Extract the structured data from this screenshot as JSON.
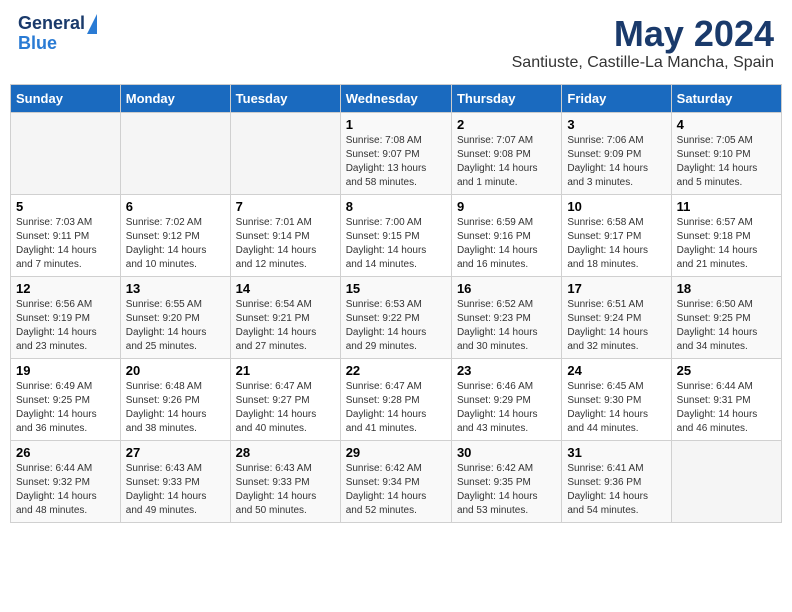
{
  "header": {
    "logo_general": "General",
    "logo_blue": "Blue",
    "month": "May 2024",
    "location": "Santiuste, Castille-La Mancha, Spain"
  },
  "days_of_week": [
    "Sunday",
    "Monday",
    "Tuesday",
    "Wednesday",
    "Thursday",
    "Friday",
    "Saturday"
  ],
  "weeks": [
    [
      {
        "day": "",
        "info": ""
      },
      {
        "day": "",
        "info": ""
      },
      {
        "day": "",
        "info": ""
      },
      {
        "day": "1",
        "info": "Sunrise: 7:08 AM\nSunset: 9:07 PM\nDaylight: 13 hours\nand 58 minutes."
      },
      {
        "day": "2",
        "info": "Sunrise: 7:07 AM\nSunset: 9:08 PM\nDaylight: 14 hours\nand 1 minute."
      },
      {
        "day": "3",
        "info": "Sunrise: 7:06 AM\nSunset: 9:09 PM\nDaylight: 14 hours\nand 3 minutes."
      },
      {
        "day": "4",
        "info": "Sunrise: 7:05 AM\nSunset: 9:10 PM\nDaylight: 14 hours\nand 5 minutes."
      }
    ],
    [
      {
        "day": "5",
        "info": "Sunrise: 7:03 AM\nSunset: 9:11 PM\nDaylight: 14 hours\nand 7 minutes."
      },
      {
        "day": "6",
        "info": "Sunrise: 7:02 AM\nSunset: 9:12 PM\nDaylight: 14 hours\nand 10 minutes."
      },
      {
        "day": "7",
        "info": "Sunrise: 7:01 AM\nSunset: 9:14 PM\nDaylight: 14 hours\nand 12 minutes."
      },
      {
        "day": "8",
        "info": "Sunrise: 7:00 AM\nSunset: 9:15 PM\nDaylight: 14 hours\nand 14 minutes."
      },
      {
        "day": "9",
        "info": "Sunrise: 6:59 AM\nSunset: 9:16 PM\nDaylight: 14 hours\nand 16 minutes."
      },
      {
        "day": "10",
        "info": "Sunrise: 6:58 AM\nSunset: 9:17 PM\nDaylight: 14 hours\nand 18 minutes."
      },
      {
        "day": "11",
        "info": "Sunrise: 6:57 AM\nSunset: 9:18 PM\nDaylight: 14 hours\nand 21 minutes."
      }
    ],
    [
      {
        "day": "12",
        "info": "Sunrise: 6:56 AM\nSunset: 9:19 PM\nDaylight: 14 hours\nand 23 minutes."
      },
      {
        "day": "13",
        "info": "Sunrise: 6:55 AM\nSunset: 9:20 PM\nDaylight: 14 hours\nand 25 minutes."
      },
      {
        "day": "14",
        "info": "Sunrise: 6:54 AM\nSunset: 9:21 PM\nDaylight: 14 hours\nand 27 minutes."
      },
      {
        "day": "15",
        "info": "Sunrise: 6:53 AM\nSunset: 9:22 PM\nDaylight: 14 hours\nand 29 minutes."
      },
      {
        "day": "16",
        "info": "Sunrise: 6:52 AM\nSunset: 9:23 PM\nDaylight: 14 hours\nand 30 minutes."
      },
      {
        "day": "17",
        "info": "Sunrise: 6:51 AM\nSunset: 9:24 PM\nDaylight: 14 hours\nand 32 minutes."
      },
      {
        "day": "18",
        "info": "Sunrise: 6:50 AM\nSunset: 9:25 PM\nDaylight: 14 hours\nand 34 minutes."
      }
    ],
    [
      {
        "day": "19",
        "info": "Sunrise: 6:49 AM\nSunset: 9:25 PM\nDaylight: 14 hours\nand 36 minutes."
      },
      {
        "day": "20",
        "info": "Sunrise: 6:48 AM\nSunset: 9:26 PM\nDaylight: 14 hours\nand 38 minutes."
      },
      {
        "day": "21",
        "info": "Sunrise: 6:47 AM\nSunset: 9:27 PM\nDaylight: 14 hours\nand 40 minutes."
      },
      {
        "day": "22",
        "info": "Sunrise: 6:47 AM\nSunset: 9:28 PM\nDaylight: 14 hours\nand 41 minutes."
      },
      {
        "day": "23",
        "info": "Sunrise: 6:46 AM\nSunset: 9:29 PM\nDaylight: 14 hours\nand 43 minutes."
      },
      {
        "day": "24",
        "info": "Sunrise: 6:45 AM\nSunset: 9:30 PM\nDaylight: 14 hours\nand 44 minutes."
      },
      {
        "day": "25",
        "info": "Sunrise: 6:44 AM\nSunset: 9:31 PM\nDaylight: 14 hours\nand 46 minutes."
      }
    ],
    [
      {
        "day": "26",
        "info": "Sunrise: 6:44 AM\nSunset: 9:32 PM\nDaylight: 14 hours\nand 48 minutes."
      },
      {
        "day": "27",
        "info": "Sunrise: 6:43 AM\nSunset: 9:33 PM\nDaylight: 14 hours\nand 49 minutes."
      },
      {
        "day": "28",
        "info": "Sunrise: 6:43 AM\nSunset: 9:33 PM\nDaylight: 14 hours\nand 50 minutes."
      },
      {
        "day": "29",
        "info": "Sunrise: 6:42 AM\nSunset: 9:34 PM\nDaylight: 14 hours\nand 52 minutes."
      },
      {
        "day": "30",
        "info": "Sunrise: 6:42 AM\nSunset: 9:35 PM\nDaylight: 14 hours\nand 53 minutes."
      },
      {
        "day": "31",
        "info": "Sunrise: 6:41 AM\nSunset: 9:36 PM\nDaylight: 14 hours\nand 54 minutes."
      },
      {
        "day": "",
        "info": ""
      }
    ]
  ]
}
